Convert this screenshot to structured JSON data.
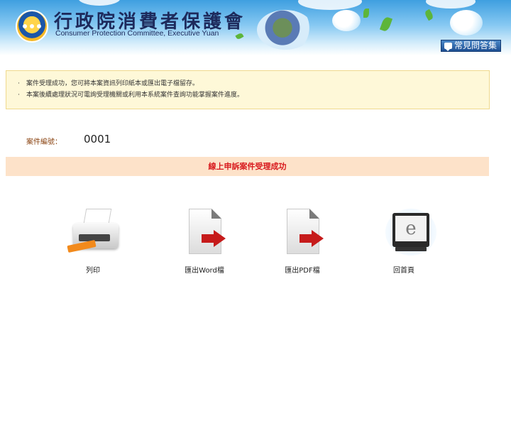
{
  "header": {
    "title_cn": "行政院消費者保護會",
    "title_en": "Consumer Protection Committee, Executive Yuan",
    "faq_label": "常見問答集"
  },
  "notice": {
    "items": [
      "案件受理成功，您可將本案資訊列印紙本或匯出電子檔留存。",
      "本案後續處理狀況可電詢受理機關或利用本系統案件查詢功能掌握案件進度。"
    ]
  },
  "case": {
    "label": "案件編號：",
    "number": "0001"
  },
  "success_message": "線上申訴案件受理成功",
  "actions": [
    {
      "label": "列印",
      "icon": "printer-icon"
    },
    {
      "label": "匯出Word檔",
      "icon": "export-word-icon"
    },
    {
      "label": "匯出PDF檔",
      "icon": "export-pdf-icon"
    },
    {
      "label": "回首頁",
      "icon": "home-ie-icon"
    }
  ],
  "colors": {
    "notice_bg": "#fef8d8",
    "success_bg": "#fde2c9",
    "success_text": "#d8181c",
    "case_label": "#8b4513"
  }
}
